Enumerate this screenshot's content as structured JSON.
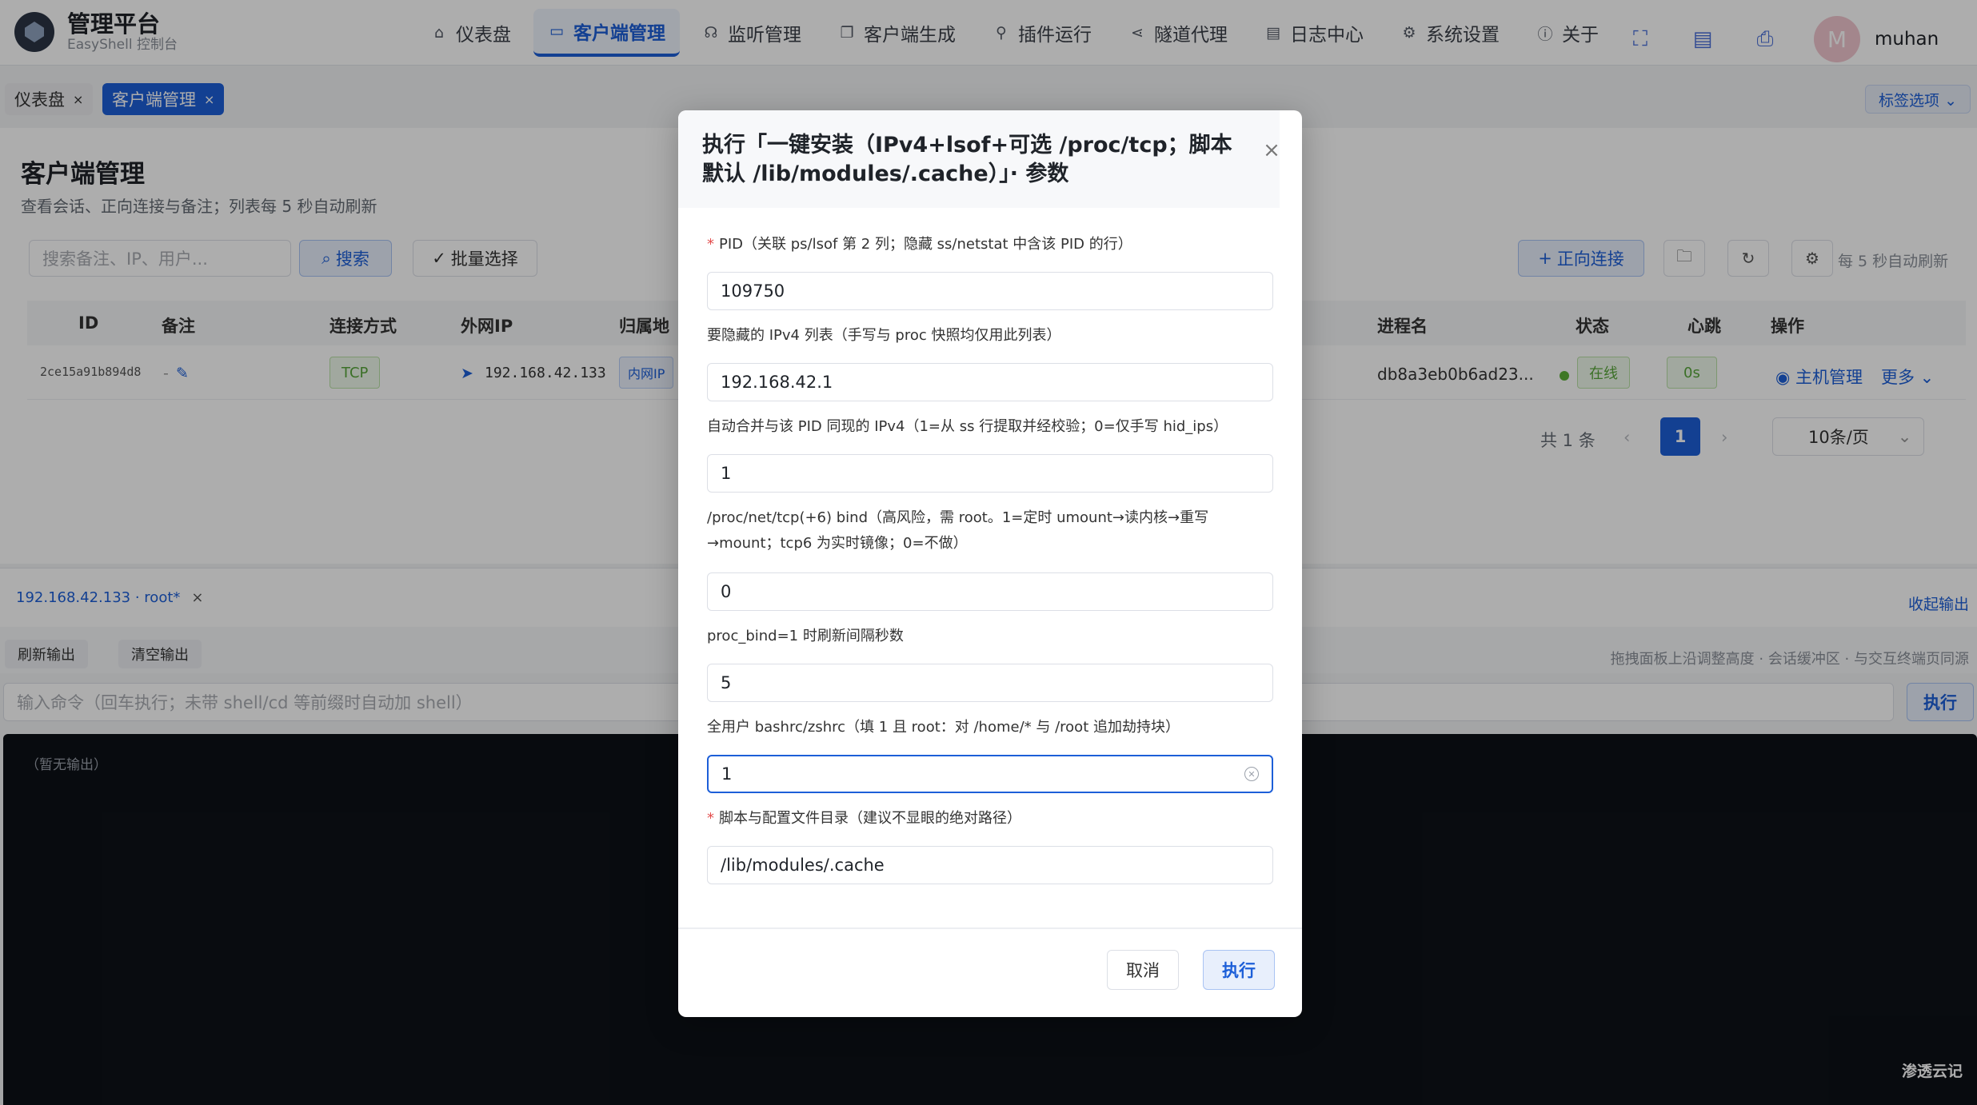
{
  "brand": {
    "title": "管理平台",
    "subtitle": "EasyShell 控制台"
  },
  "nav": {
    "items": [
      {
        "label": "仪表盘",
        "icon": "home-icon"
      },
      {
        "label": "客户端管理",
        "icon": "monitor-icon"
      },
      {
        "label": "监听管理",
        "icon": "headset-icon"
      },
      {
        "label": "客户端生成",
        "icon": "copy-icon"
      },
      {
        "label": "插件运行",
        "icon": "link-icon"
      },
      {
        "label": "隧道代理",
        "icon": "share-icon"
      },
      {
        "label": "日志中心",
        "icon": "document-icon"
      },
      {
        "label": "系统设置",
        "icon": "gear-icon"
      },
      {
        "label": "关于",
        "icon": "info-icon"
      }
    ],
    "active_index": 1
  },
  "user": {
    "avatar_letter": "M",
    "name": "muhan"
  },
  "tabs": [
    {
      "label": "仪表盘",
      "close": "×"
    },
    {
      "label": "客户端管理",
      "close": "×"
    }
  ],
  "tab_options": "标签选项 ⌄",
  "page": {
    "title": "客户端管理",
    "subtitle": "查看会话、正向连接与备注；列表每 5 秒自动刷新",
    "search_placeholder": "搜索备注、IP、用户...",
    "search_btn": "搜索",
    "batch_btn": "批量选择",
    "forward_btn": "正向连接",
    "auto_refresh": "每 5 秒自动刷新"
  },
  "table": {
    "headers": {
      "id": "ID",
      "note": "备注",
      "conn": "连接方式",
      "ip": "外网IP",
      "loc": "归属地",
      "proc": "进程名",
      "status": "状态",
      "heartbeat": "心跳",
      "ops": "操作"
    },
    "row": {
      "id": "2ce15a91b894d8",
      "note": "-",
      "conn": "TCP",
      "ip": "192.168.42.133",
      "loc": "内网IP",
      "proc": "db8a3eb0b6ad23...",
      "status": "在线",
      "heartbeat": "0s",
      "host_mgmt": "主机管理",
      "more": "更多"
    }
  },
  "pager": {
    "total": "共 1 条",
    "prev": "‹",
    "page": "1",
    "next": "›",
    "size": "10条/页"
  },
  "terminal": {
    "session_tab": "192.168.42.133 · root*",
    "collapse": "收起输出",
    "refresh_btn": "刷新输出",
    "clear_btn": "清空输出",
    "hint": "拖拽面板上沿调整高度 · 会话缓冲区 · 与交互终端页同源",
    "cmd_placeholder": "输入命令（回车执行；未带 shell/cd 等前缀时自动加 shell）",
    "exec_btn": "执行",
    "empty": "（暂无输出）",
    "watermark": "渗透云记"
  },
  "modal": {
    "title": "执行「一键安装（IPv4+lsof+可选 /proc/tcp；脚本默认 /lib/modules/.cache）」· 参数",
    "close": "×",
    "fields": [
      {
        "label": "PID（关联 ps/lsof 第 2 列；隐藏 ss/netstat 中含该 PID 的行）",
        "value": "109750",
        "required": true
      },
      {
        "label": "要隐藏的 IPv4 列表（手写与 proc 快照均仅用此列表）",
        "value": "192.168.42.1",
        "required": false
      },
      {
        "label": "自动合并与该 PID 同现的 IPv4（1=从 ss 行提取并经校验；0=仅手写 hid_ips）",
        "value": "1",
        "required": false
      },
      {
        "label": "/proc/net/tcp(+6) bind（高风险，需 root。1=定时 umount→读内核→重写→mount；tcp6 为实时镜像；0=不做）",
        "value": "0",
        "required": false
      },
      {
        "label": "proc_bind=1 时刷新间隔秒数",
        "value": "5",
        "required": false
      },
      {
        "label": "全用户 bashrc/zshrc（填 1 且 root：对 /home/* 与 /root 追加劫持块）",
        "value": "1",
        "required": false
      },
      {
        "label": "脚本与配置文件目录（建议不显眼的绝对路径）",
        "value": "/lib/modules/.cache",
        "required": true
      }
    ],
    "cancel": "取消",
    "run": "执行"
  },
  "colors": {
    "accent": "#1d5fd8",
    "success": "#58a63a",
    "danger": "#e34d4d"
  }
}
